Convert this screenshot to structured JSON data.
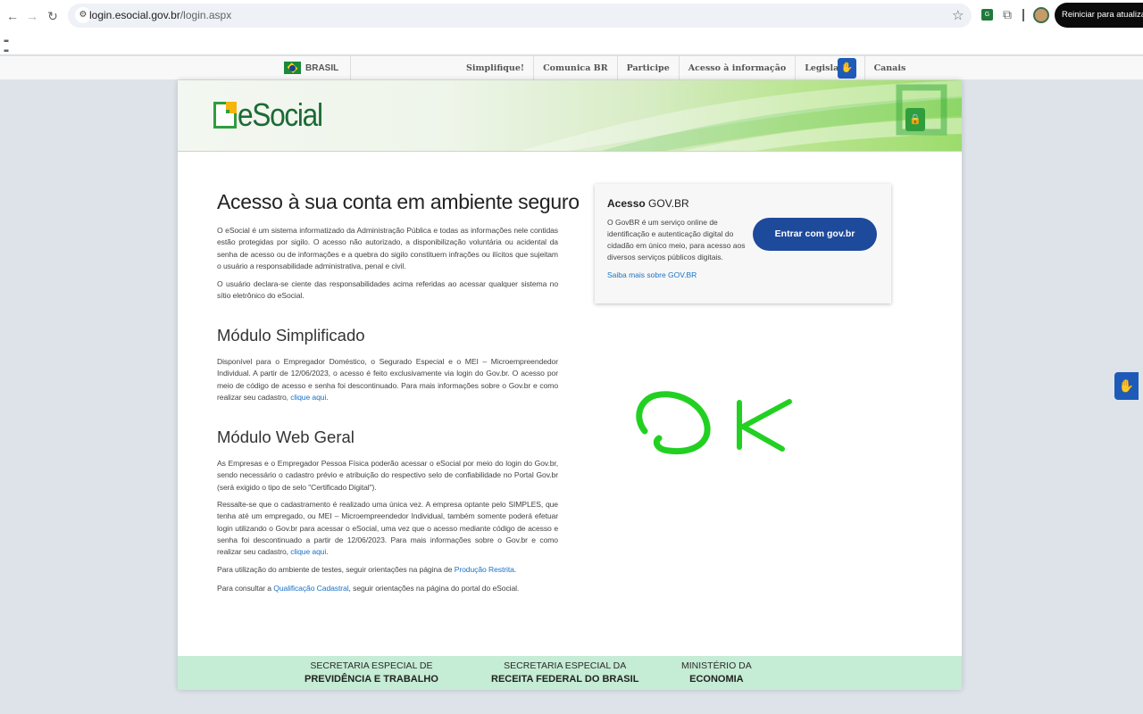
{
  "browser": {
    "url_host": "login.esocial.gov.br",
    "url_path": "/login.aspx",
    "update_button": "Reiniciar para atualizar",
    "icons": [
      "back-icon",
      "forward-icon",
      "reload-icon",
      "site-info-icon",
      "bookmark-star-icon",
      "extension-icon",
      "puzzle-icon",
      "profile-avatar",
      "apps-grid-icon"
    ]
  },
  "govbar": {
    "country": "BRASIL",
    "links": [
      "Simplifique!",
      "Comunica BR",
      "Participe",
      "Acesso à informação",
      "Legislação",
      "Canais"
    ]
  },
  "header": {
    "logo_text": "eSocial"
  },
  "main": {
    "title": "Acesso à sua conta em ambiente seguro",
    "intro_p1": "O eSocial é um sistema informatizado da Administração Pública e todas as informações nele contidas estão protegidas por sigilo. O acesso não autorizado, a disponibilização voluntária ou acidental da senha de acesso ou de informações e a quebra do sigilo constituem infrações ou ilícitos que sujeitam o usuário a responsabilidade administrativa, penal e civil.",
    "intro_p2": "O usuário declara-se ciente das responsabilidades acima referidas ao acessar qualquer sistema no sítio eletrônico do eSocial.",
    "simplificado": {
      "title": "Módulo Simplificado",
      "text": "Disponível para o Empregador Doméstico, o Segurado Especial e o MEI – Microempreendedor Individual. A partir de 12/06/2023, o acesso é feito exclusivamente via login do Gov.br. O acesso por meio de código de acesso e senha foi descontinuado. Para mais informações sobre o Gov.br e como realizar seu cadastro,",
      "link": "clique aqui",
      "end": "."
    },
    "webgeral": {
      "title": "Módulo Web Geral",
      "p1": "As Empresas e o Empregador Pessoa Física poderão acessar o eSocial por meio do login do Gov.br, sendo necessário o cadastro prévio e atribuição do respectivo selo de confiabilidade no Portal Gov.br (será exigido o tipo de selo \"Certificado Digital\").",
      "p2": "Ressalte-se que o cadastramento é realizado uma única vez. A empresa optante pelo SIMPLES, que tenha até um empregado, ou MEI – Microempreendedor Individual, também somente poderá efetuar login utilizando o Gov.br para acessar o eSocial, uma vez que o acesso mediante código de acesso e senha foi descontinuado a partir de 12/06/2023. Para mais informações sobre o Gov.br e como realizar seu cadastro,",
      "p2_link": "clique aqui",
      "p2_end": ".",
      "p3": "Para utilização do ambiente de testes, seguir orientações na página de",
      "p3_link": "Produção Restrita",
      "p3_end": ".",
      "p4": "Para consultar a",
      "p4_link": "Qualificação Cadastral",
      "p4_end": ", seguir orientações na página do portal do eSocial."
    }
  },
  "govbox": {
    "title_bold": "Acesso",
    "title_rest": "GOV.BR",
    "description": "O GovBR é um serviço online de identificação e autenticação digital do cidadão em único meio, para acesso aos diversos serviços públicos digitais.",
    "button": "Entrar com gov.br",
    "more_link": "Saiba mais sobre GOV.BR"
  },
  "annotation": {
    "text": "OK",
    "color": "#22d022"
  },
  "footer": {
    "items": [
      {
        "line1": "SECRETARIA ESPECIAL DE",
        "line2": "PREVIDÊNCIA E TRABALHO"
      },
      {
        "line1": "SECRETARIA ESPECIAL DA",
        "line2": "RECEITA FEDERAL DO BRASIL"
      },
      {
        "line1": "MINISTÉRIO DA",
        "line2": "ECONOMIA"
      }
    ]
  },
  "colors": {
    "brand_green": "#2f9e3d",
    "govbr_blue": "#1e4a9c",
    "link_blue": "#1a73c8",
    "footer_green": "#c5ecd4"
  }
}
